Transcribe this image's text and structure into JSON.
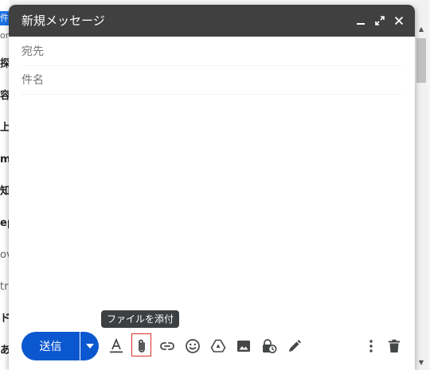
{
  "background": {
    "rows": [
      {
        "text": "件",
        "style": "sel"
      },
      {
        "text": "om",
        "style": "light"
      },
      {
        "text": "探",
        "style": ""
      },
      {
        "text": "容",
        "style": ""
      },
      {
        "text": "上",
        "style": ""
      },
      {
        "text": "m",
        "style": ""
      },
      {
        "text": "知",
        "style": ""
      },
      {
        "text": "ep",
        "style": ""
      },
      {
        "text": "ov",
        "style": "light"
      },
      {
        "text": "tra",
        "style": "light"
      },
      {
        "text": "ド",
        "style": ""
      },
      {
        "text": "ある",
        "style": ""
      }
    ]
  },
  "compose": {
    "title": "新規メッセージ",
    "to_placeholder": "宛先",
    "subject_placeholder": "件名",
    "body": "",
    "send_label": "送信",
    "tooltip": "ファイルを添付"
  },
  "colors": {
    "header": "#404040",
    "send": "#0b57d0",
    "highlight_border": "#d93025",
    "icon": "#444746"
  }
}
